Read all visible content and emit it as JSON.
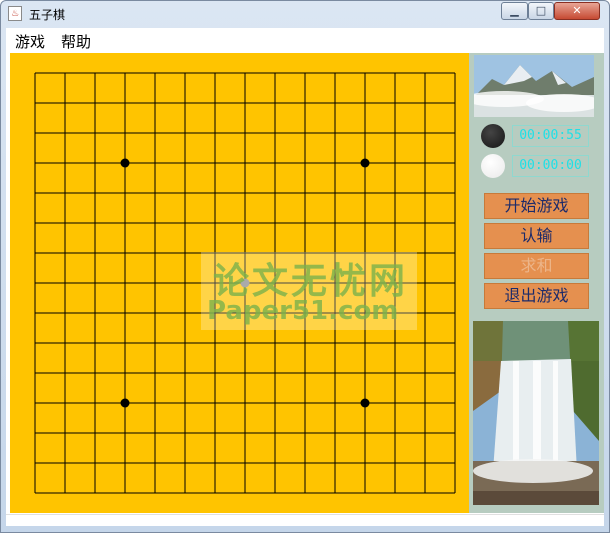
{
  "window": {
    "title": "五子棋",
    "app_icon": "java-icon",
    "controls": [
      "minimize-icon",
      "maximize-icon",
      "close-icon"
    ]
  },
  "menu": {
    "game": "游戏",
    "help": "帮助"
  },
  "board": {
    "size": 15,
    "background": "#ffc400",
    "line_color": "#000000",
    "star_points": [
      [
        3,
        3
      ],
      [
        11,
        3
      ],
      [
        3,
        11
      ],
      [
        11,
        11
      ]
    ],
    "center_point": [
      7,
      7
    ]
  },
  "watermark": {
    "line1": "论文无忧网",
    "line2": "Paper51.com"
  },
  "side_panel": {
    "black_timer": "00:00:55",
    "white_timer": "00:00:00",
    "buttons": {
      "start": "开始游戏",
      "surrender": "认输",
      "draw": "求和",
      "exit": "退出游戏"
    },
    "images": [
      "mountain-landscape",
      "waterfall"
    ]
  },
  "colors": {
    "panel_bg": "#b7ccc0",
    "button_bg": "#e5904f",
    "button_text": "#1c2b6a",
    "timer_text": "#20e0e6"
  }
}
